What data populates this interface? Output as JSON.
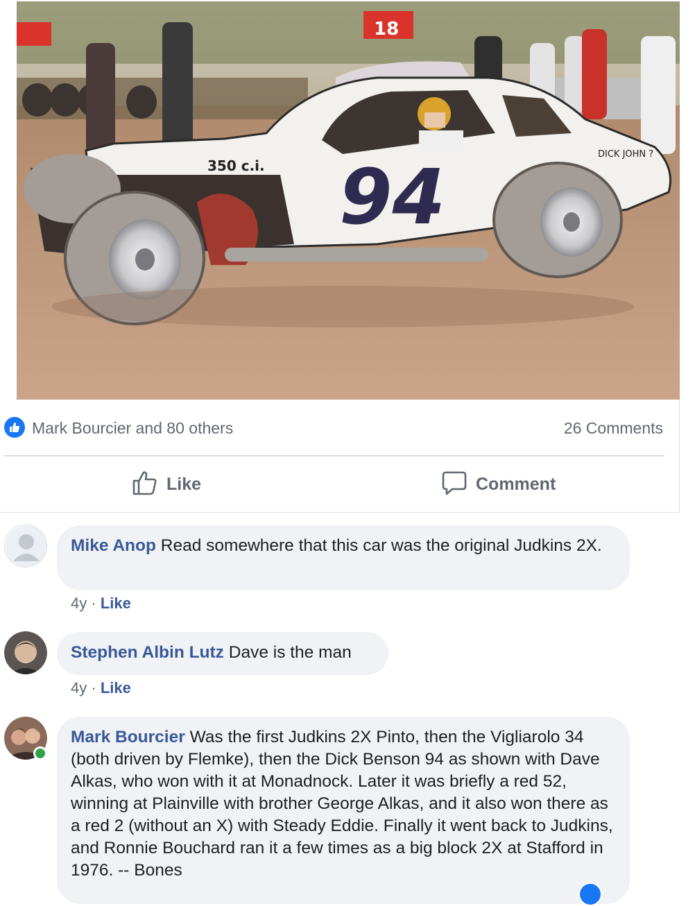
{
  "post": {
    "photo_alt": "Vintage race car photo",
    "reactions_text": "Mark Bourcier and 80 others",
    "comments_count": "26 Comments"
  },
  "actions": {
    "like_label": "Like",
    "comment_label": "Comment"
  },
  "comments": [
    {
      "author": "Mike Anop",
      "text": "Read somewhere that this car was the original Judkins 2X.",
      "age": "4y",
      "like_label": "Like"
    },
    {
      "author": "Stephen Albin Lutz",
      "text": "Dave is the man",
      "age": "4y",
      "like_label": "Like"
    },
    {
      "author": "Mark Bourcier",
      "text": "Was the first Judkins 2X Pinto, then the Vigliarolo 34 (both driven by Flemke), then the Dick Benson 94 as shown with Dave Alkas, who won with it at Monadnock. Later it was briefly a red 52, winning at Plainville with brother George Alkas, and it also won there as a red 2 (without an X) with Steady Eddie. Finally it went back to Judkins, and Ronnie Bouchard ran it a few times as a big block 2X at Stafford in 1976. -- Bones"
    }
  ],
  "photo_text": {
    "car_number": "94",
    "engine_label": "350 c.i.",
    "pit_number": "18",
    "driver_name": "DICK JOHN ?"
  },
  "colors": {
    "link": "#385898",
    "bubble": "#f0f2f5",
    "meta": "#606770",
    "brand_blue": "#1877f2",
    "online": "#31a24c"
  },
  "icons": [
    "like-badge-icon",
    "thumbs-up-icon",
    "speech-bubble-icon",
    "default-avatar-icon"
  ]
}
